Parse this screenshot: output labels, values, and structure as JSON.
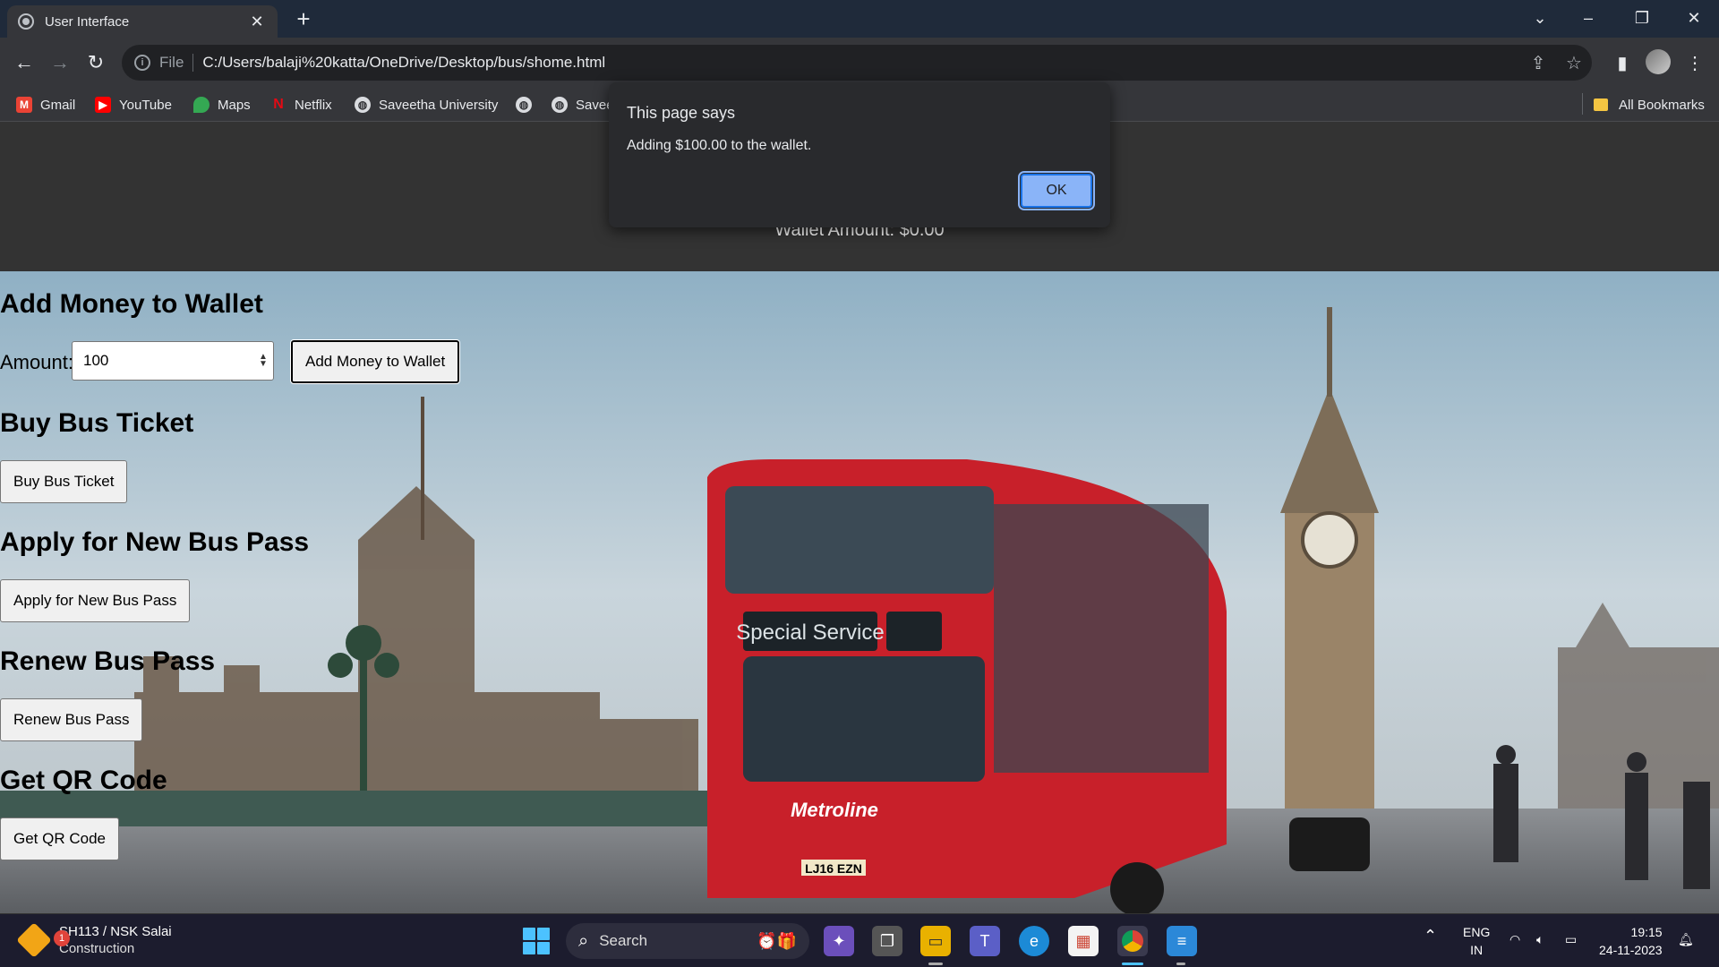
{
  "browser": {
    "tab_title": "User Interface",
    "url_scheme": "File",
    "url": "C:/Users/balaji%20katta/OneDrive/Desktop/bus/shome.html"
  },
  "bookmarks": {
    "items": [
      {
        "label": "Gmail",
        "icon": "gmail-icon",
        "color": "#ea4335"
      },
      {
        "label": "YouTube",
        "icon": "youtube-icon",
        "color": "#ff0000"
      },
      {
        "label": "Maps",
        "icon": "maps-icon",
        "color": "#34a853"
      },
      {
        "label": "Netflix",
        "icon": "netflix-icon",
        "color": "#e50914"
      },
      {
        "label": "Saveetha University",
        "icon": "globe-icon"
      },
      {
        "label": "",
        "icon": "globe-icon"
      },
      {
        "label": "Savee",
        "icon": "globe-icon"
      }
    ],
    "all_bookmarks": "All Bookmarks"
  },
  "page": {
    "wallet_amount": "Wallet Amount: $0.00",
    "add_money": {
      "heading": "Add Money to Wallet",
      "amount_label": "Amount:",
      "amount_value": "100",
      "button": "Add Money to Wallet"
    },
    "buy_ticket": {
      "heading": "Buy Bus Ticket",
      "button": "Buy Bus Ticket"
    },
    "new_pass": {
      "heading": "Apply for New Bus Pass",
      "button": "Apply for New Bus Pass"
    },
    "renew_pass": {
      "heading": "Renew Bus Pass",
      "button": "Renew Bus Pass"
    },
    "qr_code": {
      "heading": "Get QR Code",
      "button": "Get QR Code"
    },
    "background_image": "red-double-decker-bus-london-westminster-scene",
    "bus_destination_sign": "Special Service",
    "bus_brand": "Metroline",
    "bus_plate": "LJ16 EZN"
  },
  "dialog": {
    "title": "This page says",
    "message": "Adding $100.00 to the wallet.",
    "ok_label": "OK"
  },
  "taskbar": {
    "weather_title": "SH113 / NSK Salai",
    "weather_subtitle": "Construction",
    "weather_badge": "1",
    "search_placeholder": "Search",
    "language": "ENG",
    "region": "IN",
    "time": "19:15",
    "date": "24-11-2023"
  },
  "colors": {
    "page_header_bg": "#333333",
    "ok_button": "#8ab4f8",
    "windows_accent": "#4cc2ff"
  }
}
